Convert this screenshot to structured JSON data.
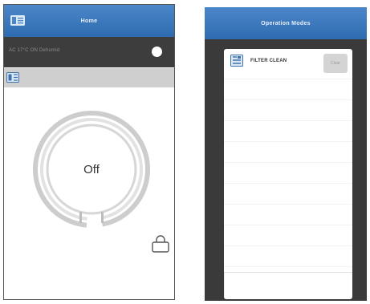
{
  "left_screen": {
    "title": "Home",
    "status_text": "AC 17°C ON Dehumid",
    "power_label": "Off"
  },
  "right_screen": {
    "title": "Operation Modes",
    "rows": [
      {
        "label": "FILTER CLEAN",
        "button": "Clear",
        "icon": "filter-icon"
      }
    ]
  },
  "icons": {
    "menu": "menu-icon",
    "mode": "mode-icon",
    "lock": "lock-icon"
  },
  "colors": {
    "title_bar": "#3a77bd",
    "status_bar": "#3d3d3d",
    "mode_strip": "#cfcfcf",
    "dial_ring": "#cfcfcf",
    "overlay_background": "#3a3a3a"
  }
}
